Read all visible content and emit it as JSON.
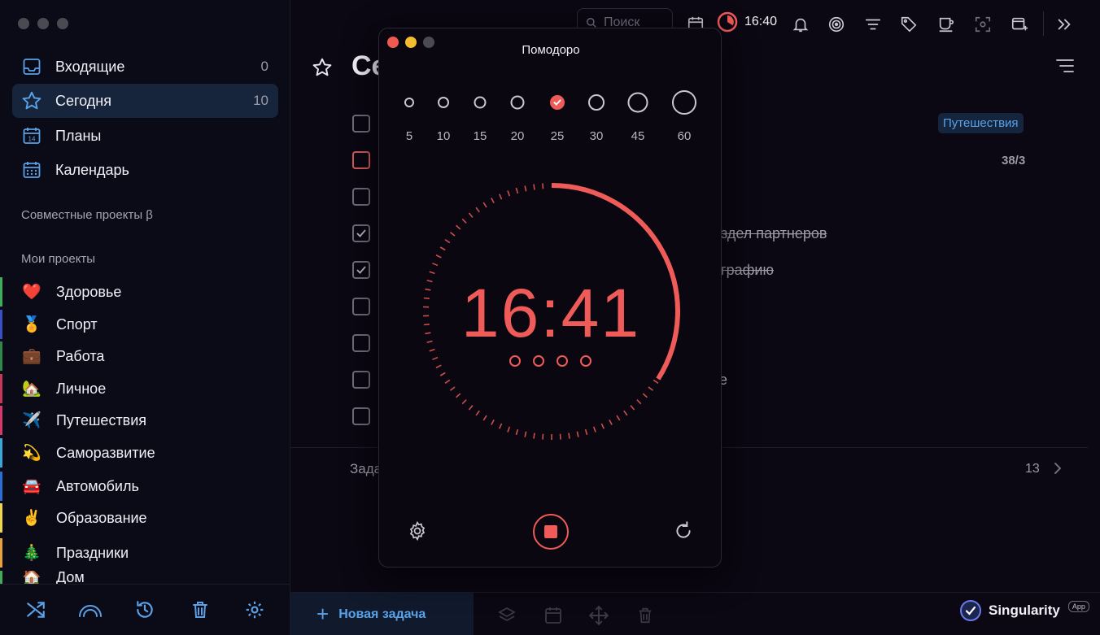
{
  "sidebar": {
    "nav": [
      {
        "label": "Входящие",
        "count": "0",
        "icon": "inbox-icon"
      },
      {
        "label": "Сегодня",
        "count": "10",
        "icon": "star-icon"
      },
      {
        "label": "Планы",
        "count": "",
        "icon": "calendar-14-icon",
        "icon_text": "14"
      },
      {
        "label": "Календарь",
        "count": "",
        "icon": "calendar-grid-icon"
      }
    ],
    "shared_title": "Совместные проекты β",
    "projects_title": "Мои проекты",
    "projects": [
      {
        "emoji": "❤️",
        "label": "Здоровье",
        "color": "#3fae5a"
      },
      {
        "emoji": "🏅",
        "label": "Спорт",
        "color": "#3b4fc4"
      },
      {
        "emoji": "💼",
        "label": "Работа",
        "color": "#2f8a4a"
      },
      {
        "emoji": "🏡",
        "label": "Личное",
        "color": "#c4375a"
      },
      {
        "emoji": "✈️",
        "label": "Путешествия",
        "color": "#d33a6b"
      },
      {
        "emoji": "💫",
        "label": "Саморазвитие",
        "color": "#39a8d8"
      },
      {
        "emoji": "🚘",
        "label": "Автомобиль",
        "color": "#2a6fd6"
      },
      {
        "emoji": "✌️",
        "label": "Образование",
        "color": "#f0d64a"
      },
      {
        "emoji": "🎄",
        "label": "Праздники",
        "color": "#e9a23a"
      },
      {
        "emoji": "🏠",
        "label": "Дом",
        "color": "#3fae5a"
      }
    ],
    "bottom_icons": [
      "shuffle-icon",
      "rainbow-icon",
      "history-icon",
      "trash-icon",
      "gear-icon"
    ]
  },
  "main": {
    "search_placeholder": "Поиск",
    "timer_time": "16:40",
    "page_title": "Сегодня",
    "tag": "Путешествия",
    "fraction": "38/3",
    "strike_1": "здел партнеров",
    "strike_2": "графию",
    "partial_text": "е",
    "group_label": "Задачи",
    "group_count": "13",
    "new_task": "Новая задача",
    "brand": "Singularity",
    "brand_badge": "App"
  },
  "pomodoro": {
    "title": "Помодоро",
    "durations": [
      "5",
      "10",
      "15",
      "20",
      "25",
      "30",
      "45",
      "60"
    ],
    "selected_duration": "25",
    "time": "16:41",
    "progress_fraction": 0.34,
    "accent": "#ef5b58",
    "sessions": 4
  },
  "colors": {
    "accent_blue": "#5aa2e8",
    "accent_red": "#ef5b58",
    "bg": "#0b0713"
  }
}
